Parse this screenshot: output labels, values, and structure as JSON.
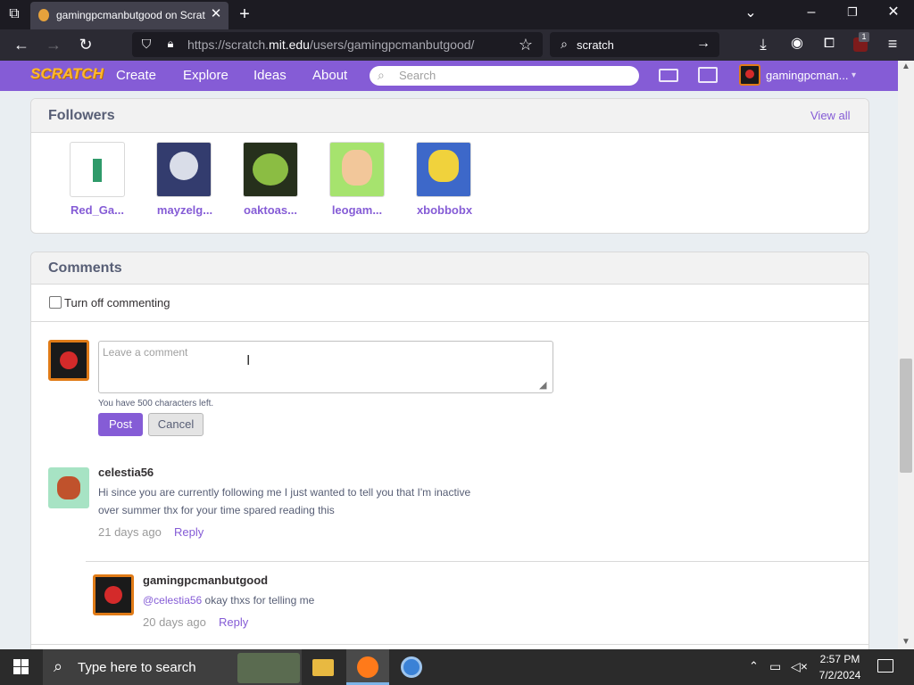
{
  "browser": {
    "tab_title": "gamingpcmanbutgood on Scrat",
    "url_prefix": "https://scratch.",
    "url_host": "mit.edu",
    "url_path": "/users/gamingpcmanbutgood/",
    "search_text": "scratch",
    "notification_count": "1"
  },
  "scratch_nav": {
    "logo": "SCRATCH",
    "items": [
      "Create",
      "Explore",
      "Ideas",
      "About"
    ],
    "search_placeholder": "Search",
    "username": "gamingpcman..."
  },
  "followers": {
    "title": "Followers",
    "view_all": "View all",
    "users": [
      "Red_Ga...",
      "mayzelg...",
      "oaktoas...",
      "leogam...",
      "xbobbobx"
    ]
  },
  "comments": {
    "title": "Comments",
    "turn_off_label": "Turn off commenting",
    "placeholder": "Leave a comment",
    "chars_left": "You have 500 characters left.",
    "post_label": "Post",
    "cancel_label": "Cancel",
    "items": [
      {
        "author": "celestia56",
        "line1": "Hi since you are currently following me I just wanted to tell you that I'm inactive",
        "line2": "over summer thx for your time spared reading this",
        "time": "21 days ago",
        "reply": "Reply"
      },
      {
        "author": "gamingpcmanbutgood",
        "mention": "@celestia56",
        "text": " okay thxs for telling me",
        "time": "20 days ago",
        "reply": "Reply"
      }
    ]
  },
  "taskbar": {
    "search_placeholder": "Type here to search",
    "time": "2:57 PM",
    "date": "7/2/2024"
  },
  "colors": {
    "scratch_purple": "#855cd6",
    "chrome_dark": "#1c1b22",
    "taskbar": "#2b2b2b"
  }
}
